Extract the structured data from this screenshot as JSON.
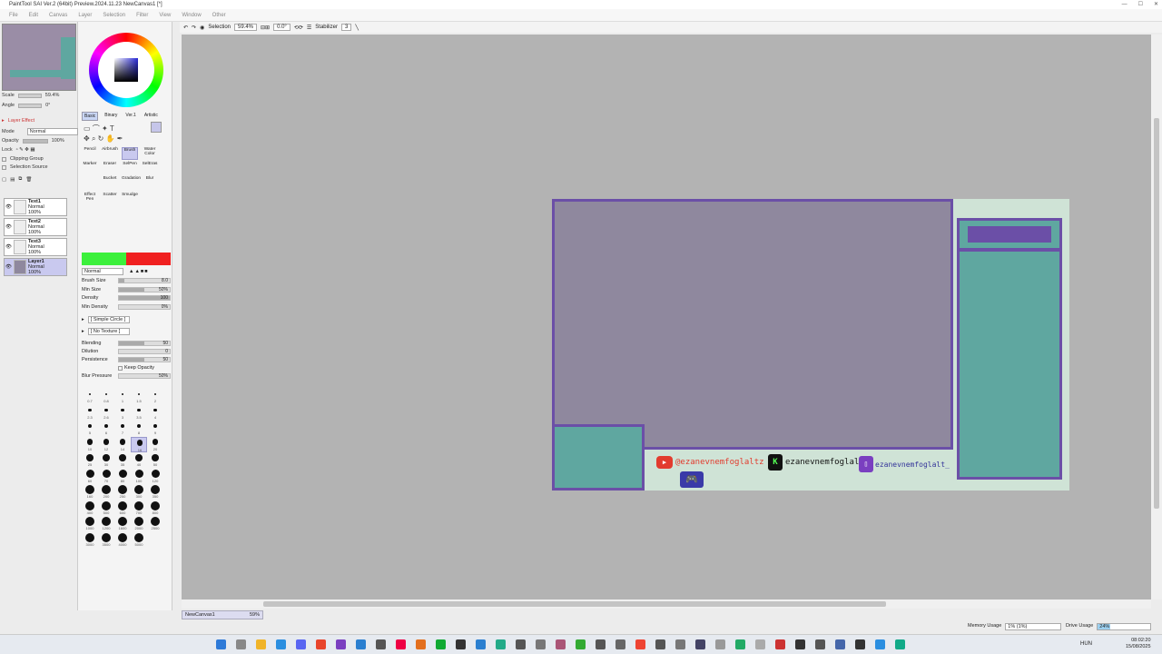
{
  "window": {
    "title": "PaintTool SAI Ver.2 (64bit) Preview.2024.11.23   NewCanvas1 [*]",
    "menu": [
      "File",
      "Edit",
      "Canvas",
      "Layer",
      "Selection",
      "Filter",
      "View",
      "Window",
      "Other"
    ]
  },
  "navigator": {
    "scale_label": "Scale",
    "scale_value": "59.4%",
    "angle_label": "Angle",
    "angle_value": "0°"
  },
  "layer_panel": {
    "effect_label": "Layer Effect",
    "mode_label": "Mode",
    "mode_value": "Normal",
    "opacity_label": "Opacity",
    "opacity_value": "100%",
    "lock_label": "Lock",
    "clipping_label": "Clipping Group",
    "selection_source_label": "Selection Source",
    "layers": [
      {
        "name": "Text1",
        "mode": "Normal",
        "opacity": "100%"
      },
      {
        "name": "Text2",
        "mode": "Normal",
        "opacity": "100%"
      },
      {
        "name": "Text3",
        "mode": "Normal",
        "opacity": "100%"
      },
      {
        "name": "Layer1",
        "mode": "Normal",
        "opacity": "100%"
      }
    ]
  },
  "color_tabs": [
    "Basic",
    "Binary",
    "Ver.1",
    "Artistic"
  ],
  "tools": [
    "Pencil",
    "Airbrush",
    "Brush",
    "Water Color",
    "Marker",
    "Eraser",
    "SelPen",
    "SelEras",
    "Bucket",
    "Gradation",
    "Blur",
    "Effect Pen",
    "Scatter",
    "Smudge"
  ],
  "brush": {
    "mode": "Normal",
    "params": [
      {
        "label": "Brush Size",
        "value": "8.0",
        "fill": 0.1
      },
      {
        "label": "Min Size",
        "value": "50%",
        "fill": 0.5
      },
      {
        "label": "Density",
        "value": "100",
        "fill": 1.0
      },
      {
        "label": "Min Density",
        "value": "0%",
        "fill": 0.0
      }
    ],
    "shape": "[ Simple Circle ]",
    "texture": "[ No Texture ]",
    "mix": [
      {
        "label": "Blending",
        "value": "50",
        "fill": 0.5
      },
      {
        "label": "Dilution",
        "value": "0",
        "fill": 0.0
      },
      {
        "label": "Persistence",
        "value": "50",
        "fill": 0.5
      }
    ],
    "keep_opacity": "Keep Opacity",
    "blur_pressure_label": "Blur Pressure",
    "blur_pressure_value": "50%",
    "sizes": [
      "0.7",
      "0.8",
      "1",
      "1.5",
      "2",
      "2.3",
      "2.6",
      "3",
      "3.5",
      "4",
      "5",
      "6",
      "7",
      "8",
      "9",
      "10",
      "12",
      "14",
      "16",
      "20",
      "25",
      "30",
      "35",
      "40",
      "50",
      "60",
      "70",
      "80",
      "100",
      "120",
      "160",
      "200",
      "250",
      "300",
      "350",
      "400",
      "500",
      "600",
      "700",
      "800",
      "1000",
      "1200",
      "1600",
      "2000",
      "2500",
      "3000",
      "3500",
      "4000",
      "5000"
    ]
  },
  "toolbar": {
    "selection_label": "Selection",
    "zoom": "59.4%",
    "angle": "0.0°",
    "stabilizer_label": "Stabilizer",
    "stabilizer_value": "3"
  },
  "canvas_content": {
    "handles": [
      {
        "handle": "@ezanevnemfoglaltz",
        "color": "#e23b2e"
      },
      {
        "handle": "ezanevnemfoglalt",
        "color": "#111111"
      },
      {
        "handle": "ezanevnemfoglalt_",
        "color": "#333399"
      }
    ]
  },
  "status": {
    "tab": "NewCanvas1",
    "tab_zoom": "59%",
    "memory_label": "Memory Usage",
    "memory_value": "1% (1%)",
    "drive_label": "Drive Usage",
    "drive_value": "24%"
  },
  "taskbar": {
    "lang": "HUN",
    "time": "08:02:20",
    "date": "15/08/2025"
  },
  "colors": {
    "teal": "#5fa7a0",
    "purple": "#6b4fa7",
    "canvas_bg": "#8f889e",
    "frame": "#6b4fa7",
    "light": "#cfe3d6"
  }
}
